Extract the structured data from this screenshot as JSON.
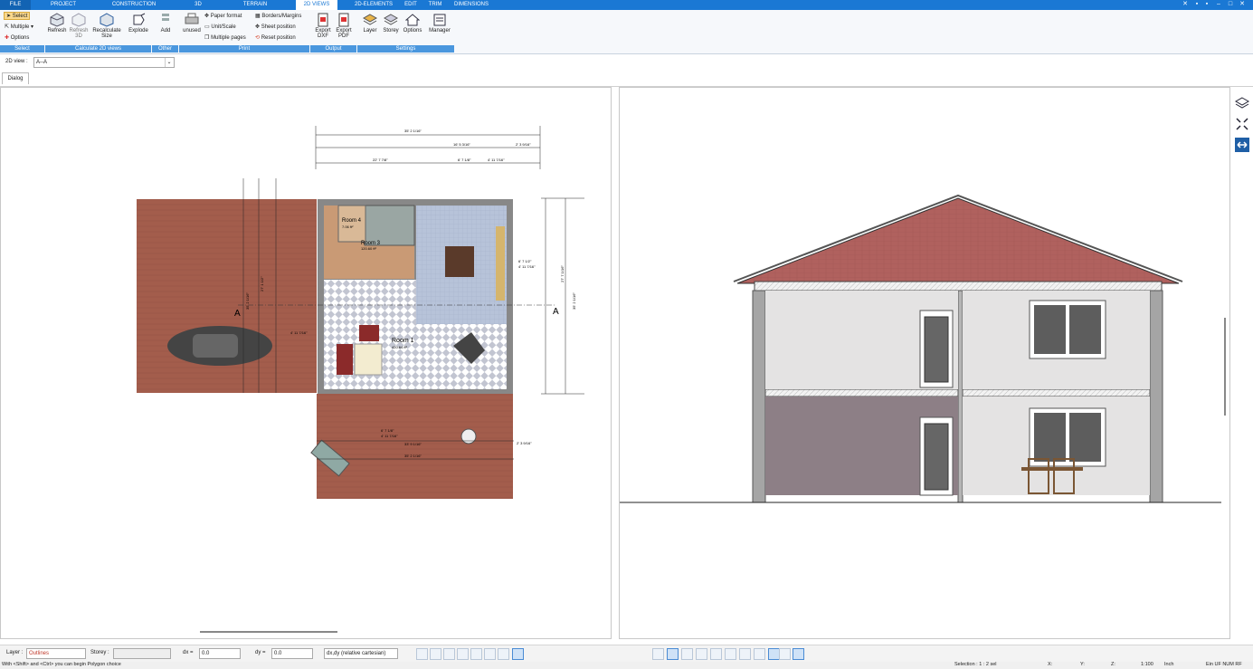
{
  "menubar": {
    "tabs": [
      "FILE",
      "PROJECT",
      "CONSTRUCTION",
      "3D",
      "TERRAIN",
      "2D VIEWS",
      "2D-ELEMENTS",
      "EDIT",
      "TRIM",
      "DIMENSIONS"
    ],
    "active_tab": "2D VIEWS"
  },
  "ribbon": {
    "select": {
      "select": "Select",
      "multiple": "Multiple",
      "options": "Options",
      "group": "Select"
    },
    "calc": {
      "refresh": "Refresh",
      "refresh3d": "Refresh 3D",
      "recalc": "Recalculate Size",
      "explode": "Explode",
      "group": "Calculate 2D views"
    },
    "other": {
      "add": "Add",
      "group": "Other"
    },
    "print": {
      "unused": "unused",
      "paper": "Paper format",
      "unit": "Unit/Scale",
      "multiple": "Multiple pages",
      "borders": "Borders/Margins",
      "sheet": "Sheet position",
      "reset": "Reset position",
      "group": "Print"
    },
    "output": {
      "dxf": "Export DXF",
      "pdf": "Export PDF",
      "group": "Output"
    },
    "settings": {
      "layer": "Layer",
      "storey": "Storey",
      "options": "Options",
      "manager": "Manager",
      "group": "Settings"
    }
  },
  "view_selector": {
    "label": "2D view :",
    "value": "A--A"
  },
  "dialog_tab": "Dialog",
  "plan": {
    "room4": "Room 4",
    "room4_area": "7.06 ft²",
    "room3": "Room 3",
    "room3_area": "120.60 ft²",
    "room1": "Room 1",
    "room1_area": "420.64 ft²",
    "section_left": "A",
    "section_right": "A",
    "dims_top": [
      "35' 2 1/16\"",
      "22' 7 7/8\"",
      "6' 7 1/8\"",
      "4' 11 7/16\"",
      "16' 5 3/16\"",
      "2' 3 9/16\""
    ],
    "dims_bottom": [
      "33' 9 1/16\"",
      "35' 2 1/16\"",
      "6' 7 1/8\"",
      "4' 11 7/16\"",
      "2' 3 9/16\""
    ],
    "dims_right": [
      "35' 2 1/16\"",
      "27' 7 1/16\"",
      "6' 7 1/2\"",
      "4' 11 7/16\""
    ],
    "dims_left": [
      "35' 2 1/16\"",
      "27' 1 1/2\"",
      "4' 11 7/16\""
    ]
  },
  "bottom": {
    "layer_label": "Layer :",
    "layer_value": "Outlines",
    "storey_label": "Storey :",
    "dx_label": "dx =",
    "dx_value": "0.0",
    "dy_label": "dy =",
    "dy_value": "0.0",
    "coord_mode": "dx,dy (relative cartesian)"
  },
  "status": {
    "hint": "With <Shift> and <Ctrl> you can begin Polygon choice",
    "selection": "Selection : 1 : 2 sel",
    "x": "X:",
    "y": "Y:",
    "z": "Z:",
    "scale": "1:100",
    "unit": "Inch",
    "flags": "Ein   UF   NUM   RF"
  },
  "colors": {
    "accent": "#1a78d4",
    "roof": "#b0615e",
    "floor": "#9d5b4f",
    "wall_dark": "#8d7f86"
  }
}
